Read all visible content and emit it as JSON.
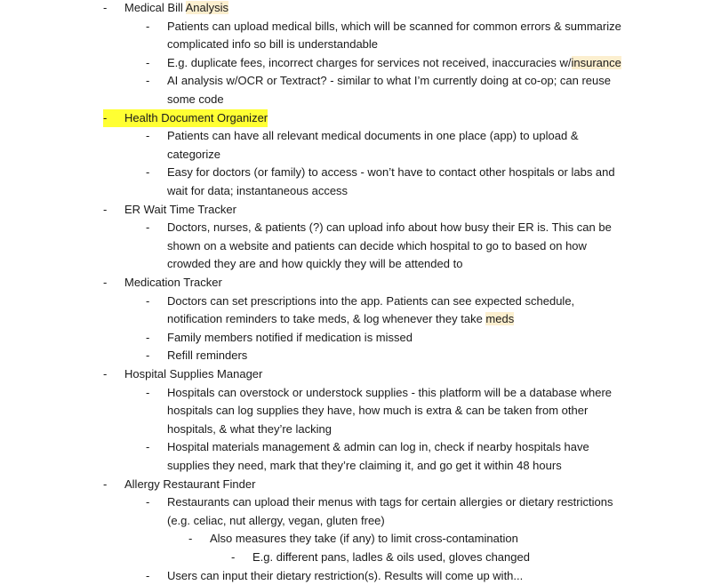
{
  "highlight_colors": {
    "strong": "#ffff33",
    "soft": "#fcefcf"
  },
  "lines": [
    {
      "bullet": "-",
      "level": 0,
      "segments": [
        {
          "t": "Medical Bill "
        },
        {
          "t": "Analysis",
          "hl": "soft"
        }
      ]
    },
    {
      "bullet": "-",
      "level": 1,
      "segments": [
        {
          "t": "Patients can upload medical bills, which will be scanned for common errors & summarize"
        }
      ]
    },
    {
      "bullet": "",
      "level": 1,
      "segments": [
        {
          "t": "complicated info so bill is understandable"
        }
      ]
    },
    {
      "bullet": "-",
      "level": 1,
      "segments": [
        {
          "t": "E.g. duplicate fees, incorrect charges for services not received, inaccuracies w/"
        },
        {
          "t": "insurance",
          "hl": "soft"
        }
      ]
    },
    {
      "bullet": "-",
      "level": 1,
      "segments": [
        {
          "t": "AI analysis w/OCR or Textract? - similar to what I’m currently doing at co-op; can reuse"
        }
      ]
    },
    {
      "bullet": "",
      "level": 1,
      "segments": [
        {
          "t": "some code"
        }
      ]
    },
    {
      "bullet": "-",
      "level": 0,
      "hl_line": "strong",
      "segments": [
        {
          "t": "Health Document Organizer"
        }
      ]
    },
    {
      "bullet": "-",
      "level": 1,
      "segments": [
        {
          "t": "Patients can have all relevant medical documents in one place (app) to upload &"
        }
      ]
    },
    {
      "bullet": "",
      "level": 1,
      "segments": [
        {
          "t": "categorize"
        }
      ]
    },
    {
      "bullet": "-",
      "level": 1,
      "segments": [
        {
          "t": "Easy for doctors (or family) to access - won’t have to contact other hospitals or labs and"
        }
      ]
    },
    {
      "bullet": "",
      "level": 1,
      "segments": [
        {
          "t": "wait for data; instantaneous access"
        }
      ]
    },
    {
      "bullet": "-",
      "level": 0,
      "segments": [
        {
          "t": "ER Wait Time Tracker"
        }
      ]
    },
    {
      "bullet": "-",
      "level": 1,
      "segments": [
        {
          "t": "Doctors, nurses, & patients (?) can upload info about how busy their ER is. This can be"
        }
      ]
    },
    {
      "bullet": "",
      "level": 1,
      "segments": [
        {
          "t": "shown on a website and patients can decide which hospital to go to based on how"
        }
      ]
    },
    {
      "bullet": "",
      "level": 1,
      "segments": [
        {
          "t": "crowded they are and how quickly they will be attended to"
        }
      ]
    },
    {
      "bullet": "-",
      "level": 0,
      "segments": [
        {
          "t": "Medication Tracker"
        }
      ]
    },
    {
      "bullet": "-",
      "level": 1,
      "segments": [
        {
          "t": "Doctors can set prescriptions into the app. Patients can see expected schedule,"
        }
      ]
    },
    {
      "bullet": "",
      "level": 1,
      "segments": [
        {
          "t": "notification reminders to take meds, & log whenever they take "
        },
        {
          "t": "meds",
          "hl": "soft"
        }
      ]
    },
    {
      "bullet": "-",
      "level": 1,
      "segments": [
        {
          "t": "Family members notified if medication is missed"
        }
      ]
    },
    {
      "bullet": "-",
      "level": 1,
      "segments": [
        {
          "t": "Refill reminders"
        }
      ]
    },
    {
      "bullet": "-",
      "level": 0,
      "segments": [
        {
          "t": "Hospital Supplies Manager"
        }
      ]
    },
    {
      "bullet": "-",
      "level": 1,
      "segments": [
        {
          "t": "Hospitals can overstock or understock supplies - this platform will be a database where"
        }
      ]
    },
    {
      "bullet": "",
      "level": 1,
      "segments": [
        {
          "t": "hospitals can log supplies they have, how much is extra & can be taken from other"
        }
      ]
    },
    {
      "bullet": "",
      "level": 1,
      "segments": [
        {
          "t": "hospitals, & what they’re lacking"
        }
      ]
    },
    {
      "bullet": "-",
      "level": 1,
      "segments": [
        {
          "t": "Hospital materials management & admin can log in, check if nearby hospitals have"
        }
      ]
    },
    {
      "bullet": "",
      "level": 1,
      "segments": [
        {
          "t": "supplies they need, mark that they’re claiming it, and go get it within 48 hours"
        }
      ]
    },
    {
      "bullet": "-",
      "level": 0,
      "segments": [
        {
          "t": "Allergy Restaurant Finder"
        }
      ]
    },
    {
      "bullet": "-",
      "level": 1,
      "segments": [
        {
          "t": "Restaurants can upload their menus with tags for certain allergies or dietary restrictions"
        }
      ]
    },
    {
      "bullet": "",
      "level": 1,
      "segments": [
        {
          "t": "(e.g. celiac, nut allergy, vegan, gluten free)"
        }
      ]
    },
    {
      "bullet": "-",
      "level": 2,
      "segments": [
        {
          "t": "Also measures they take (if any) to limit cross-contamination"
        }
      ]
    },
    {
      "bullet": "-",
      "level": 3,
      "segments": [
        {
          "t": "E.g. different pans, ladles & oils used, gloves changed"
        }
      ]
    },
    {
      "bullet": "-",
      "level": 1,
      "segments": [
        {
          "t": "Users can input their dietary restriction(s). Results will come up with..."
        }
      ]
    }
  ]
}
